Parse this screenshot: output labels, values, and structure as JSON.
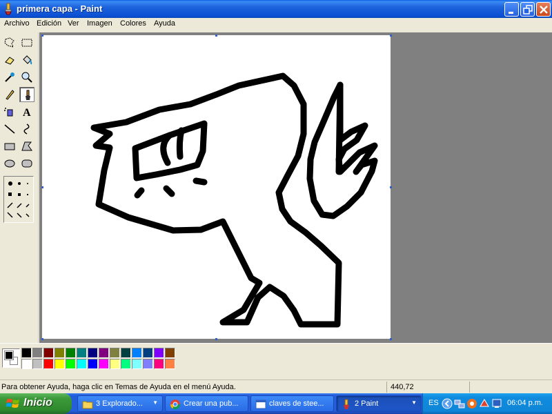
{
  "window": {
    "title": "primera capa - Paint",
    "buttons": [
      "minimize",
      "maximize",
      "close"
    ]
  },
  "menubar": {
    "items": [
      "Archivo",
      "Edición",
      "Ver",
      "Imagen",
      "Colores",
      "Ayuda"
    ]
  },
  "toolbox": {
    "tools": [
      {
        "icon": "free-select-icon"
      },
      {
        "icon": "rect-select-icon"
      },
      {
        "icon": "eraser-icon"
      },
      {
        "icon": "fill-bucket-icon"
      },
      {
        "icon": "color-picker-icon"
      },
      {
        "icon": "magnifier-icon"
      },
      {
        "icon": "pencil-icon"
      },
      {
        "icon": "brush-icon",
        "active": true
      },
      {
        "icon": "airbrush-icon"
      },
      {
        "icon": "text-icon"
      },
      {
        "icon": "line-icon"
      },
      {
        "icon": "curve-icon"
      },
      {
        "icon": "rectangle-icon"
      },
      {
        "icon": "polygon-icon"
      },
      {
        "icon": "ellipse-icon"
      },
      {
        "icon": "rounded-rect-icon"
      }
    ]
  },
  "palette": {
    "foreground": "#000000",
    "background": "#ffffff",
    "row1": [
      "#000000",
      "#808080",
      "#800000",
      "#808000",
      "#008000",
      "#008080",
      "#000080",
      "#800080",
      "#808040",
      "#004040",
      "#0080ff",
      "#004080",
      "#8000ff",
      "#804000"
    ],
    "row2": [
      "#ffffff",
      "#c0c0c0",
      "#ff0000",
      "#ffff00",
      "#00ff00",
      "#00ffff",
      "#0000ff",
      "#ff00ff",
      "#ffff80",
      "#00ff80",
      "#80ffff",
      "#8080ff",
      "#ff0080",
      "#ff8040"
    ]
  },
  "statusbar": {
    "help": "Para obtener Ayuda, haga clic en Temas de Ayuda en el menú Ayuda.",
    "coords": "440,72"
  },
  "taskbar": {
    "start_label": "Inicio",
    "tasks": [
      {
        "label": "3 Explorado...",
        "icon": "folder-icon",
        "has_arrow": true
      },
      {
        "label": "Crear una pub...",
        "icon": "chrome-icon",
        "has_arrow": false
      },
      {
        "label": "claves de stee...",
        "icon": "window-icon",
        "has_arrow": false
      },
      {
        "label": "2 Paint",
        "icon": "paint-icon",
        "has_arrow": true,
        "active": true
      }
    ],
    "tray": {
      "language": "ES",
      "clock": "06:04 p.m."
    }
  }
}
